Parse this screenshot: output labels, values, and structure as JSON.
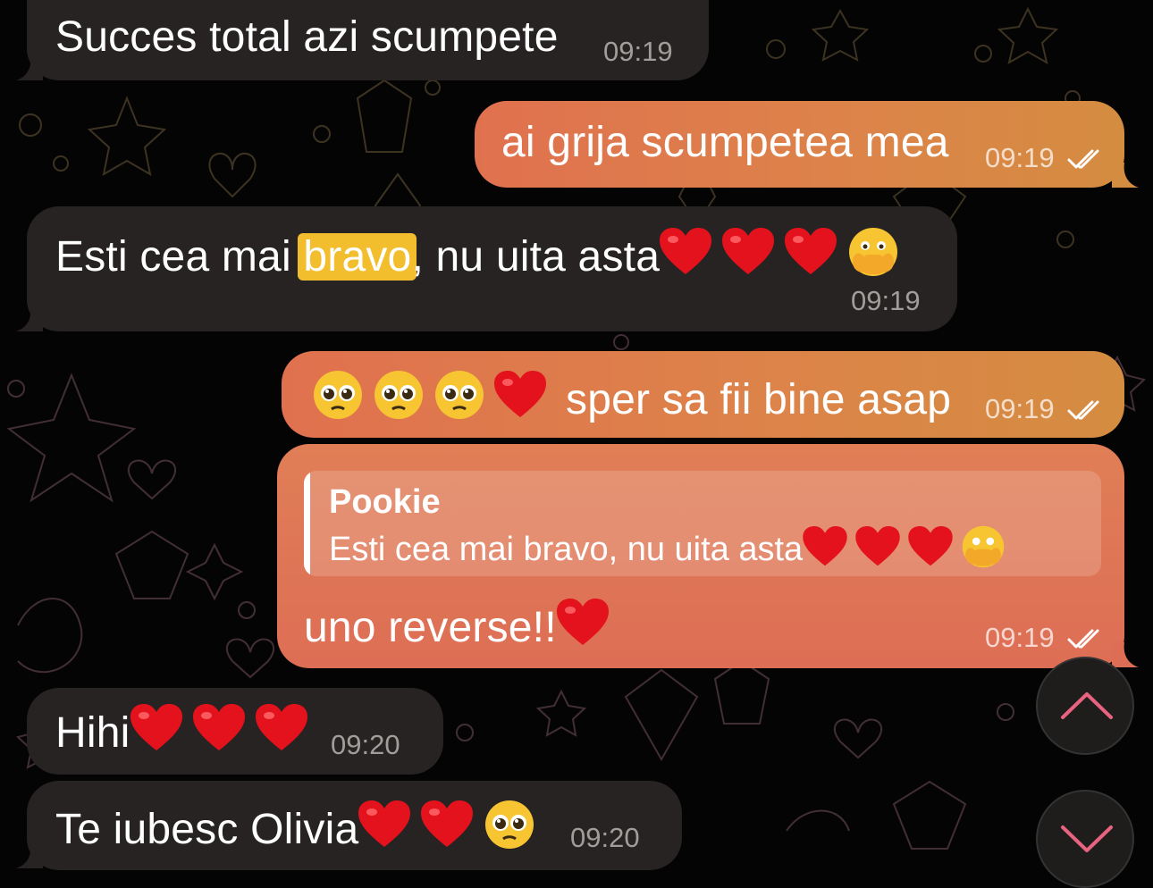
{
  "colors": {
    "incoming_bubble": "#262322",
    "outgoing_gradient_start": "#e0714f",
    "outgoing_gradient_end": "#d48c40",
    "highlight": "#f2be2d",
    "scroll_arrow": "#e8637f",
    "background": "#050404"
  },
  "messages": [
    {
      "direction": "in",
      "text": "Succes total azi scumpete",
      "time": "09:19"
    },
    {
      "direction": "out",
      "text": "ai grija scumpetea mea",
      "time": "09:19",
      "read": true
    },
    {
      "direction": "in",
      "text_before": "Esti cea mai ",
      "highlighted": "bravo",
      "text_after": ", nu uita asta",
      "emoji": [
        "heart",
        "heart",
        "heart",
        "face-with-hand-over-mouth"
      ],
      "time": "09:19"
    },
    {
      "direction": "out",
      "emoji": [
        "pleading-face",
        "pleading-face",
        "pleading-face",
        "heart"
      ],
      "text": "sper sa fii bine asap",
      "time": "09:19",
      "read": true
    },
    {
      "direction": "out",
      "reply": {
        "author": "Pookie",
        "text": "Esti cea mai bravo, nu uita asta",
        "emoji": [
          "heart",
          "heart",
          "heart",
          "face-with-hand-over-mouth"
        ]
      },
      "text": "uno reverse!!",
      "emoji": [
        "heart"
      ],
      "time": "09:19",
      "read": true
    },
    {
      "direction": "in",
      "text": "Hihi",
      "emoji": [
        "heart",
        "heart",
        "heart"
      ],
      "time": "09:20"
    },
    {
      "direction": "in",
      "text": "Te iubesc Olivia",
      "emoji": [
        "heart",
        "heart",
        "pleading-face"
      ],
      "time": "09:20"
    }
  ],
  "controls": {
    "scroll_up_icon": "chevron-up-icon",
    "scroll_down_icon": "chevron-down-icon"
  }
}
